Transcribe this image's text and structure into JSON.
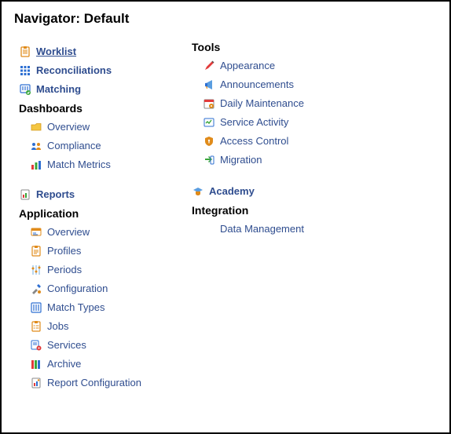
{
  "title": "Navigator: Default",
  "left": {
    "worklist": "Worklist",
    "reconciliations": "Reconciliations",
    "matching": "Matching",
    "dashboards_header": "Dashboards",
    "dash_overview": "Overview",
    "dash_compliance": "Compliance",
    "dash_match_metrics": "Match Metrics",
    "reports": "Reports",
    "application_header": "Application",
    "app_overview": "Overview",
    "app_profiles": "Profiles",
    "app_periods": "Periods",
    "app_configuration": "Configuration",
    "app_match_types": "Match Types",
    "app_jobs": "Jobs",
    "app_services": "Services",
    "app_archive": "Archive",
    "app_report_config": "Report Configuration"
  },
  "right": {
    "tools_header": "Tools",
    "tools_appearance": "Appearance",
    "tools_announcements": "Announcements",
    "tools_daily_maintenance": "Daily Maintenance",
    "tools_service_activity": "Service Activity",
    "tools_access_control": "Access Control",
    "tools_migration": "Migration",
    "academy": "Academy",
    "integration_header": "Integration",
    "data_management": "Data Management"
  }
}
